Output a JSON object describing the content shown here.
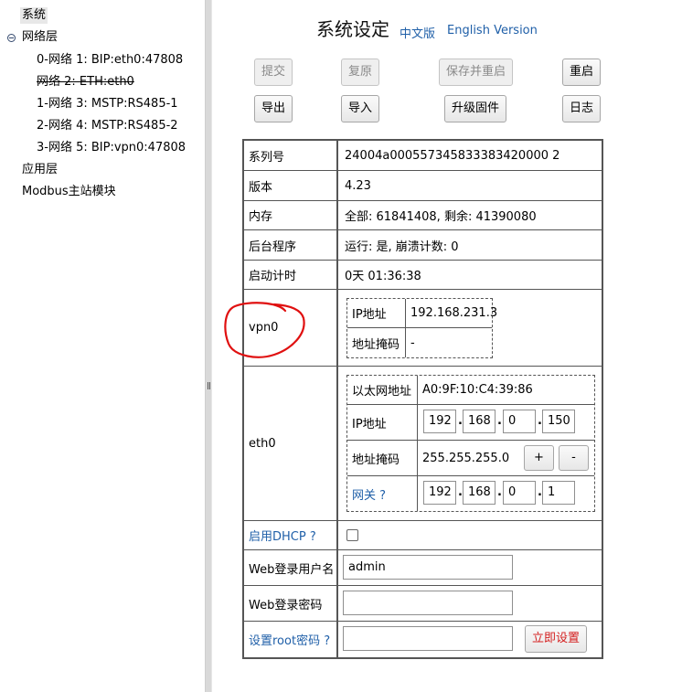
{
  "tree": {
    "system": "系统",
    "network_layer": "网络层",
    "nets": [
      "0-网络 1: BIP:eth0:47808",
      "网络 2: ETH:eth0",
      "1-网络 3: MSTP:RS485-1",
      "2-网络 4: MSTP:RS485-2",
      "3-网络 5: BIP:vpn0:47808"
    ],
    "app_layer": "应用层",
    "modbus": "Modbus主站模块"
  },
  "header": {
    "title": "系统设定",
    "lang_cn": "中文版",
    "lang_en": "English Version"
  },
  "toolbar": {
    "submit": "提交",
    "restore": "复原",
    "save_restart": "保存并重启",
    "restart": "重启",
    "export": "导出",
    "import": "导入",
    "upgrade": "升级固件",
    "log": "日志"
  },
  "info": {
    "serial_label": "系列号",
    "serial_value": "24004a000557345833383420000 2",
    "version_label": "版本",
    "version_value": "4.23",
    "memory_label": "内存",
    "memory_value": "全部: 61841408, 剩余: 41390080",
    "daemon_label": "后台程序",
    "daemon_value": "运行: 是, 崩溃计数: 0",
    "uptime_label": "启动计时",
    "uptime_value": "0天 01:36:38",
    "vpn0": {
      "label": "vpn0",
      "ip_label": "IP地址",
      "ip_value": "192.168.231.3",
      "mask_label": "地址掩码",
      "mask_value": "-"
    },
    "eth0": {
      "label": "eth0",
      "mac_label": "以太网地址",
      "mac_value": "A0:9F:10:C4:39:86",
      "ip_label": "IP地址",
      "ip": [
        "192",
        "168",
        "0",
        "150"
      ],
      "mask_label": "地址掩码",
      "mask_value": "255.255.255.0",
      "plus": "+",
      "minus": "-",
      "gw_label": "网关 ?",
      "gw": [
        "192",
        "168",
        "0",
        "1"
      ]
    },
    "dhcp_label": "启用DHCP ?",
    "web_user_label": "Web登录用户名",
    "web_user_value": "admin",
    "web_pass_label": "Web登录密码",
    "web_pass_value": "",
    "root_label": "设置root密码 ?",
    "root_value": "",
    "root_button": "立即设置"
  },
  "colors": {
    "link": "#1f5fa8",
    "annotation": "#e01010",
    "danger": "#d42020"
  }
}
